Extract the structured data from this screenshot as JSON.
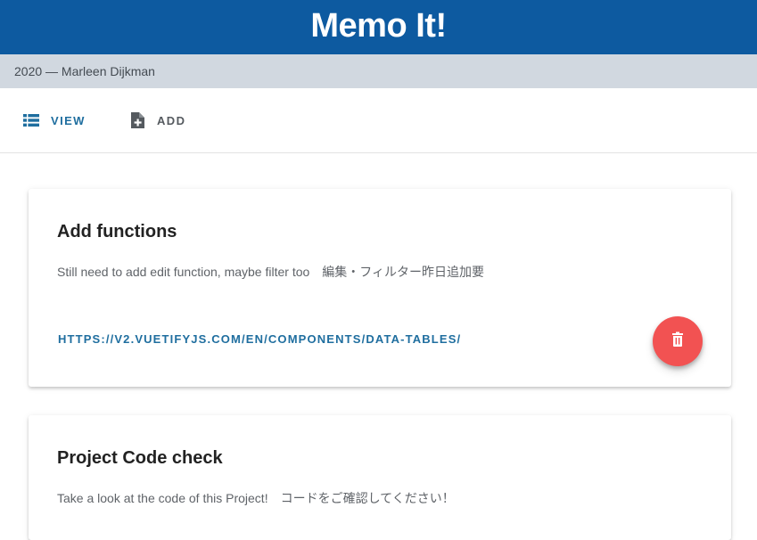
{
  "app": {
    "title": "Memo It!",
    "subtitle": "2020 — Marleen Dijkman"
  },
  "tabs": [
    {
      "label": "VIEW",
      "icon": "view-list-icon",
      "active": true
    },
    {
      "label": "ADD",
      "icon": "note-add-icon",
      "active": false
    }
  ],
  "memos": [
    {
      "title": "Add functions",
      "text": "Still need to add edit function, maybe filter too　編集・フィルター昨日追加要",
      "link": "HTTPS://V2.VUETIFYJS.COM/EN/COMPONENTS/DATA-TABLES/",
      "action_icon": "trash-icon"
    },
    {
      "title": "Project Code check",
      "text": "Take a look at the code of this Project!　コードをご確認してください！"
    }
  ],
  "colors": {
    "brand": "#0d5aa0",
    "accent": "#1f6e9f",
    "danger": "#f25252",
    "subheader": "#d1d8e0"
  }
}
